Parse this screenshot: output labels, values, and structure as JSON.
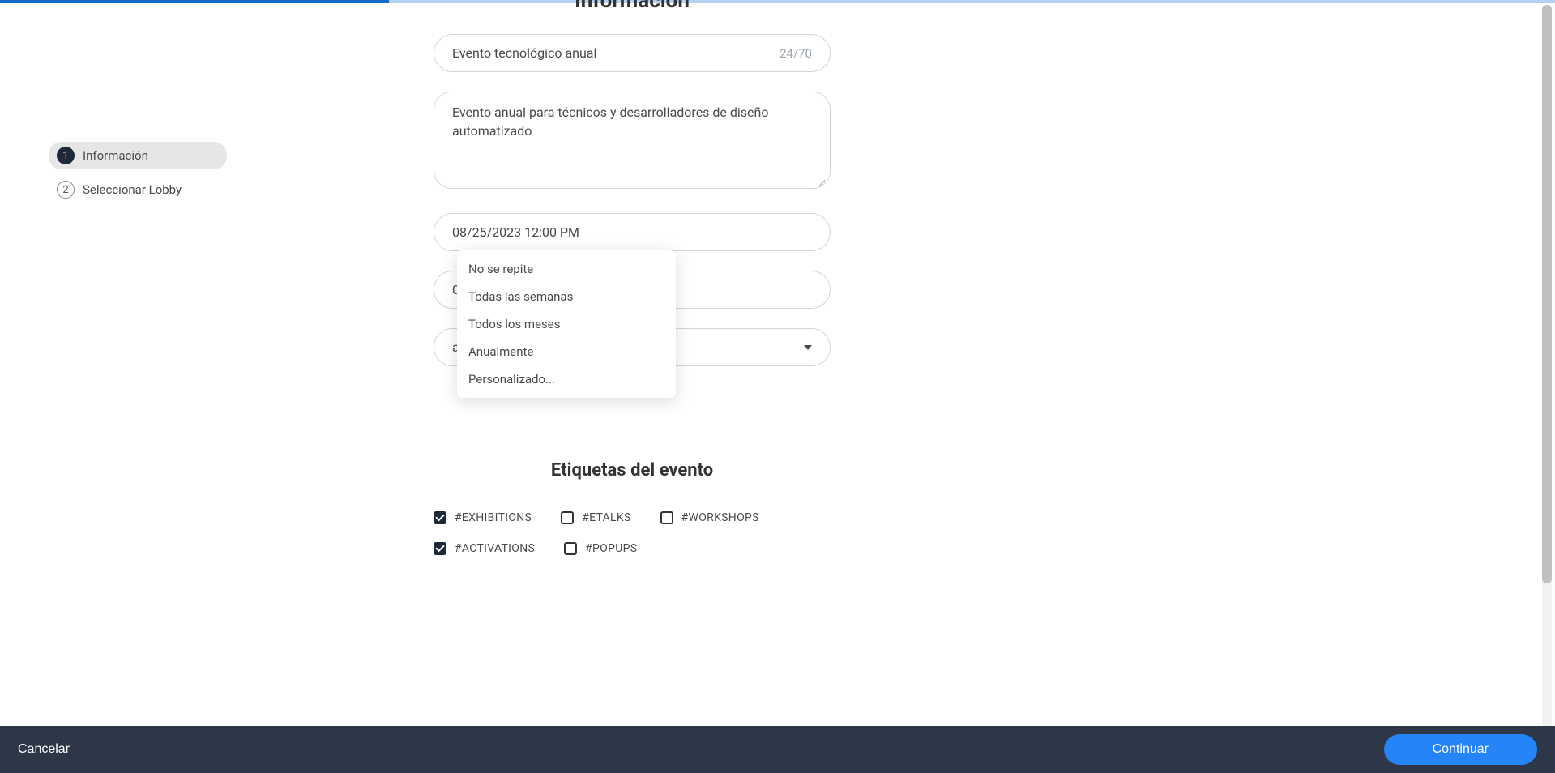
{
  "header": {
    "title": "Información"
  },
  "sidebar": {
    "steps": [
      {
        "num": "1",
        "label": "Información",
        "active": true
      },
      {
        "num": "2",
        "label": "Seleccionar Lobby",
        "active": false
      }
    ]
  },
  "form": {
    "event_title": "Evento tecnológico anual",
    "char_count": "24/70",
    "description": "Evento anual para técnicos y desarrolladores de diseño automatizado",
    "start_datetime": "08/25/2023 12:00 PM",
    "end_datetime_partial": "0",
    "visibility_partial": "ada)",
    "repeat_trigger": "No se repite"
  },
  "dropdown": {
    "options": [
      "No se repite",
      "Todas las semanas",
      "Todos los meses",
      "Anualmente",
      "Personalizado..."
    ]
  },
  "tags": {
    "title": "Etiquetas del evento",
    "items": [
      {
        "label": "#EXHIBITIONS",
        "checked": true
      },
      {
        "label": "#ETALKS",
        "checked": false
      },
      {
        "label": "#WORKSHOPS",
        "checked": false
      },
      {
        "label": "#ACTIVATIONS",
        "checked": true
      },
      {
        "label": "#POPUPS",
        "checked": false
      }
    ]
  },
  "footer": {
    "cancel": "Cancelar",
    "continue": "Continuar"
  }
}
